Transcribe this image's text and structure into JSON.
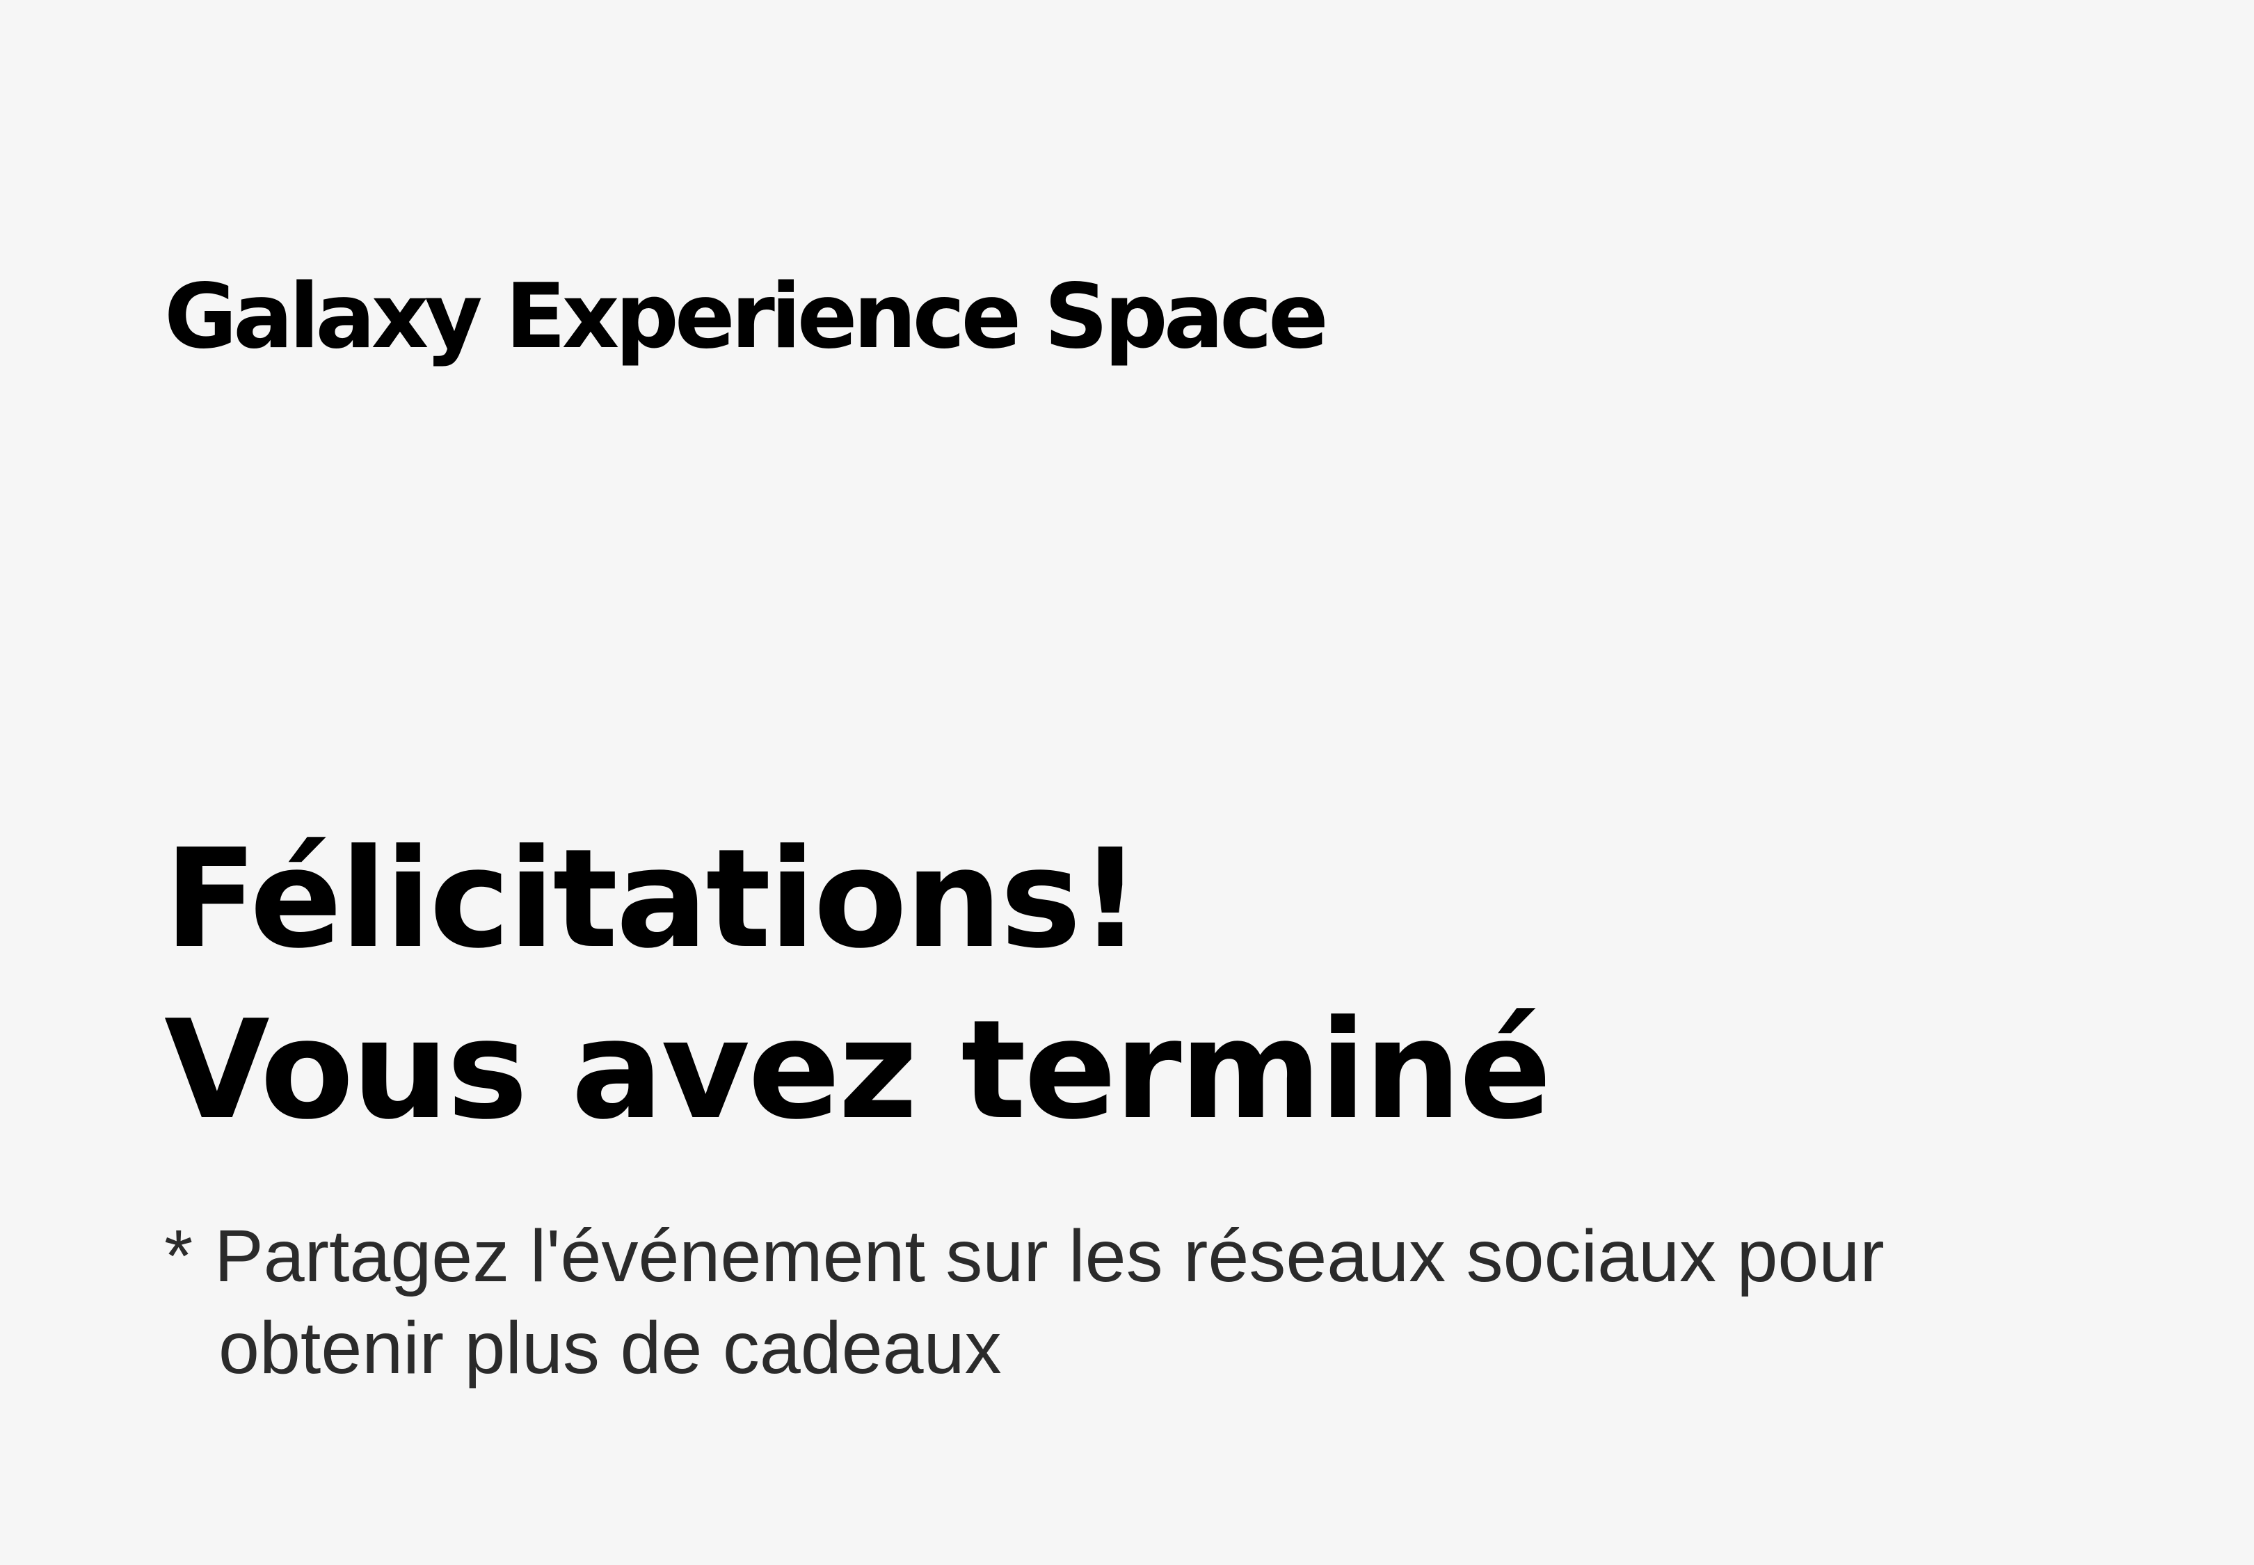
{
  "header": {
    "brand": "Galaxy Experience Space"
  },
  "main": {
    "headline_line1": "Félicitations!",
    "headline_line2": "Vous avez terminé",
    "note_marker": "*",
    "note_line1": "Partagez l'événement sur les réseaux sociaux pour",
    "note_line2": "obtenir plus de cadeaux"
  },
  "colors": {
    "background": "#f6f6f6",
    "text_primary": "#000000",
    "text_secondary": "#2b2b2b"
  }
}
